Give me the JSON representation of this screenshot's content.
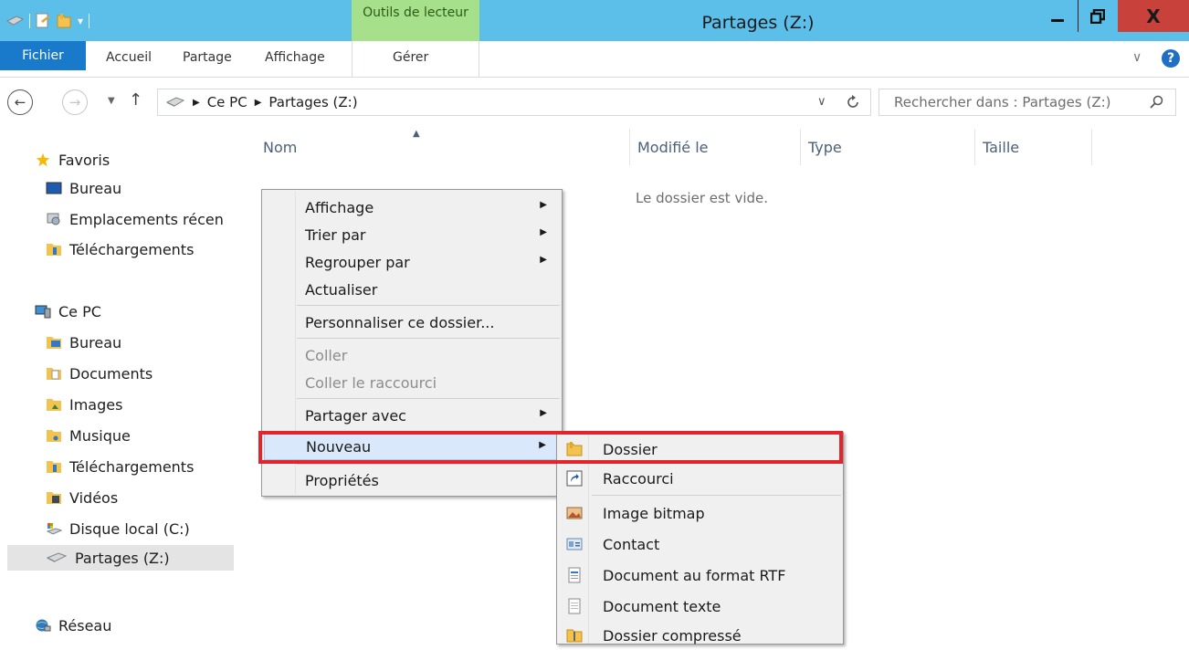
{
  "window": {
    "title": "Partages (Z:)",
    "contextual_tab_group": "Outils de lecteur",
    "close_label": "X"
  },
  "ribbon": {
    "tabs": [
      "Fichier",
      "Accueil",
      "Partage",
      "Affichage",
      "Gérer"
    ],
    "expand_glyph": "∨",
    "help_glyph": "?"
  },
  "address": {
    "crumbs": [
      "Ce PC",
      "Partages (Z:)"
    ],
    "search_placeholder": "Rechercher dans : Partages (Z:)"
  },
  "nav_pane": {
    "favorites": {
      "label": "Favoris",
      "items": [
        "Bureau",
        "Emplacements récen",
        "Téléchargements"
      ]
    },
    "this_pc": {
      "label": "Ce PC",
      "items": [
        "Bureau",
        "Documents",
        "Images",
        "Musique",
        "Téléchargements",
        "Vidéos",
        "Disque local (C:)",
        "Partages (Z:)"
      ]
    },
    "network": {
      "label": "Réseau"
    },
    "selected": "Partages (Z:)"
  },
  "columns": [
    "Nom",
    "Modifié le",
    "Type",
    "Taille"
  ],
  "empty_message": "Le dossier est vide.",
  "context_menu": {
    "items": [
      {
        "label": "Affichage",
        "submenu": true,
        "enabled": true
      },
      {
        "label": "Trier par",
        "submenu": true,
        "enabled": true
      },
      {
        "label": "Regrouper par",
        "submenu": true,
        "enabled": true
      },
      {
        "label": "Actualiser",
        "submenu": false,
        "enabled": true
      },
      {
        "label": "Personnaliser ce dossier...",
        "submenu": false,
        "enabled": true
      },
      {
        "label": "Coller",
        "submenu": false,
        "enabled": false
      },
      {
        "label": "Coller le raccourci",
        "submenu": false,
        "enabled": false
      },
      {
        "label": "Partager avec",
        "submenu": true,
        "enabled": true
      },
      {
        "label": "Nouveau",
        "submenu": true,
        "enabled": true,
        "active": true
      },
      {
        "label": "Propriétés",
        "submenu": false,
        "enabled": true
      }
    ]
  },
  "new_submenu": {
    "items": [
      {
        "label": "Dossier",
        "icon": "folder-icon",
        "highlighted": true
      },
      {
        "label": "Raccourci",
        "icon": "shortcut-icon"
      },
      {
        "label": "Image bitmap",
        "icon": "bitmap-icon"
      },
      {
        "label": "Contact",
        "icon": "contact-icon"
      },
      {
        "label": "Document au format RTF",
        "icon": "rtf-document-icon"
      },
      {
        "label": "Document texte",
        "icon": "text-document-icon"
      },
      {
        "label": "Dossier compressé",
        "icon": "zip-folder-icon"
      }
    ]
  },
  "colors": {
    "titlebar": "#5bbfe9",
    "contextual_tab": "#a7e08a",
    "file_tab": "#1979ca",
    "close_button": "#c8413b",
    "highlight_box": "#e3242b"
  }
}
